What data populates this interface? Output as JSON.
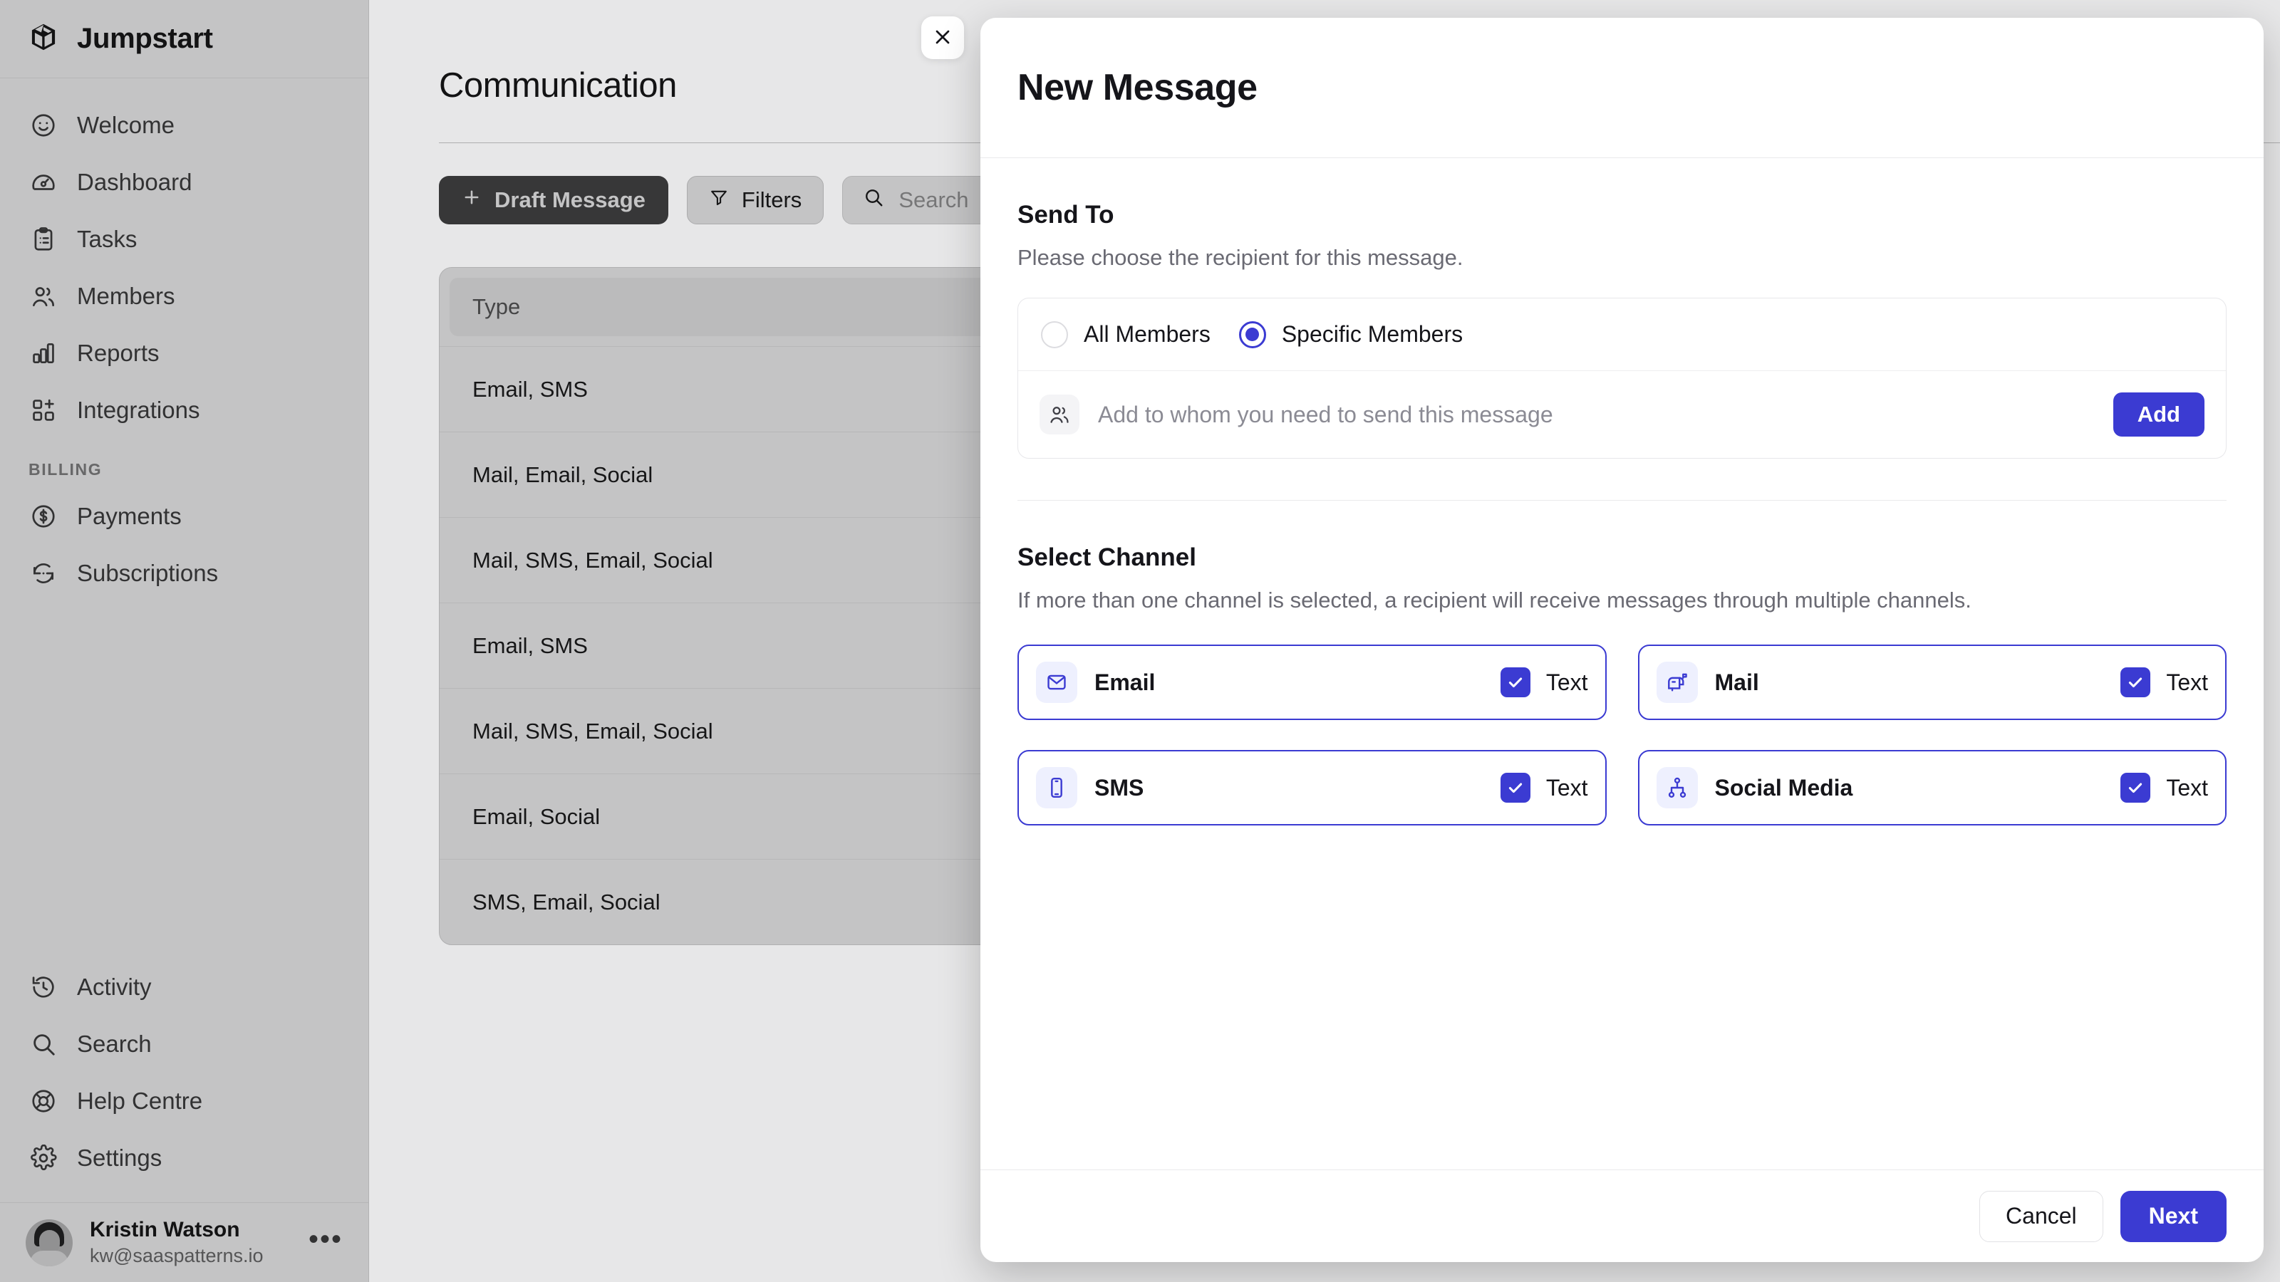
{
  "brand": {
    "name": "Jumpstart",
    "logo_icon": "cube-logo-icon"
  },
  "sidebar": {
    "items": [
      {
        "label": "Welcome",
        "icon": "smiley-icon"
      },
      {
        "label": "Dashboard",
        "icon": "gauge-icon"
      },
      {
        "label": "Tasks",
        "icon": "clipboard-icon"
      },
      {
        "label": "Members",
        "icon": "users-icon"
      },
      {
        "label": "Reports",
        "icon": "bar-chart-icon"
      },
      {
        "label": "Integrations",
        "icon": "grid-plus-icon"
      }
    ],
    "section_label": "BILLING",
    "billing_items": [
      {
        "label": "Payments",
        "icon": "dollar-circle-icon"
      },
      {
        "label": "Subscriptions",
        "icon": "refresh-icon"
      }
    ],
    "bottom_items": [
      {
        "label": "Activity",
        "icon": "history-clock-icon"
      },
      {
        "label": "Search",
        "icon": "search-icon"
      },
      {
        "label": "Help Centre",
        "icon": "lifebuoy-icon"
      },
      {
        "label": "Settings",
        "icon": "gear-icon"
      }
    ],
    "user": {
      "name": "Kristin Watson",
      "email": "kw@saaspatterns.io",
      "menu_icon": "ellipsis-icon"
    }
  },
  "main": {
    "page_title": "Communication",
    "toolbar": {
      "draft_label": "Draft Message",
      "draft_icon": "plus-icon",
      "filters_label": "Filters",
      "filters_icon": "funnel-icon",
      "search_placeholder": "Search",
      "search_icon": "search-icon",
      "search_value": ""
    },
    "table": {
      "columns": [
        "Type"
      ],
      "rows": [
        "Email, SMS",
        "Mail, Email, Social",
        "Mail, SMS, Email, Social",
        "Email, SMS",
        "Mail, SMS, Email, Social",
        "Email, Social",
        "SMS, Email, Social"
      ]
    }
  },
  "modal": {
    "title": "New Message",
    "close_icon": "close-icon",
    "send_to": {
      "heading": "Send To",
      "description": "Please choose the recipient for this message.",
      "options": [
        {
          "label": "All Members",
          "selected": false
        },
        {
          "label": "Specific Members",
          "selected": true
        }
      ],
      "add_placeholder": "Add to whom you need to send this message",
      "add_icon": "users-icon",
      "add_button": "Add"
    },
    "select_channel": {
      "heading": "Select Channel",
      "description": "If more than one channel is selected, a recipient will receive messages through multiple channels.",
      "channels": [
        {
          "label": "Email",
          "icon": "envelope-icon",
          "checked": true,
          "check_label": "Text"
        },
        {
          "label": "Mail",
          "icon": "mailbox-icon",
          "checked": true,
          "check_label": "Text"
        },
        {
          "label": "SMS",
          "icon": "phone-icon",
          "checked": true,
          "check_label": "Text"
        },
        {
          "label": "Social Media",
          "icon": "share-network-icon",
          "checked": true,
          "check_label": "Text"
        }
      ]
    },
    "footer": {
      "cancel_label": "Cancel",
      "next_label": "Next"
    }
  },
  "colors": {
    "primary": "#3b3bd2",
    "primary_soft": "#eef0fe",
    "text": "#15151a",
    "muted": "#6a6a73"
  }
}
